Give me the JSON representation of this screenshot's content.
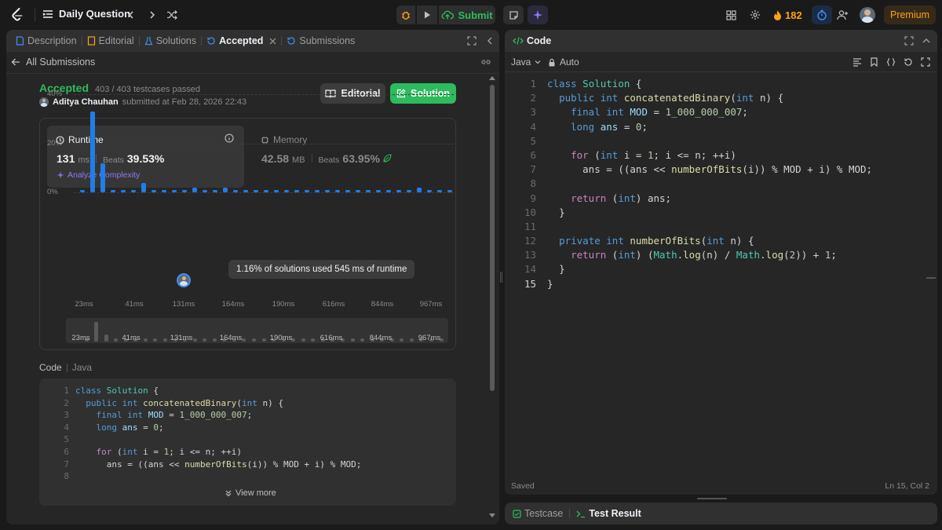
{
  "topbar": {
    "problem_list_label": "Daily Question",
    "submit_label": "Submit",
    "streak_count": "182",
    "premium_label": "Premium"
  },
  "left_panel": {
    "tabs": [
      {
        "label": "Description"
      },
      {
        "label": "Editorial"
      },
      {
        "label": "Solutions"
      },
      {
        "label": "Accepted"
      },
      {
        "label": "Submissions"
      }
    ],
    "back_label": "All Submissions",
    "status": "Accepted",
    "testcases": "403 / 403 testcases passed",
    "user_name": "Aditya Chauhan",
    "submitted_at": "submitted at Feb 28, 2026 22:43",
    "editorial_button": "Editorial",
    "solution_button": "Solution",
    "runtime": {
      "label": "Runtime",
      "value": "131",
      "unit": "ms",
      "beats_label": "Beats",
      "beats_value": "39.53%",
      "analyze_label": "Analyze Complexity"
    },
    "memory": {
      "label": "Memory",
      "value": "42.58",
      "unit": "MB",
      "beats_label": "Beats",
      "beats_value": "63.95%"
    },
    "tooltip": "1.16% of solutions used 545 ms of runtime",
    "code_label": "Code",
    "code_lang": "Java",
    "view_more": "View more"
  },
  "chart_data": {
    "type": "bar",
    "y_ticks": [
      "40%",
      "20%",
      "0%"
    ],
    "ylim": [
      0,
      40
    ],
    "x_tick_labels": [
      "23ms",
      "41ms",
      "131ms",
      "164ms",
      "190ms",
      "616ms",
      "844ms",
      "967ms"
    ],
    "values": [
      1,
      33,
      12,
      1,
      1,
      1,
      4,
      1,
      1,
      1,
      1,
      2,
      1,
      1,
      2,
      1,
      1,
      1,
      1,
      1,
      1,
      1,
      1,
      1,
      1,
      1,
      1,
      1,
      1,
      1,
      1,
      1,
      1,
      2,
      1,
      1,
      1
    ]
  },
  "right_panel": {
    "tab_label": "Code",
    "language": "Java",
    "mode": "Auto",
    "saved_label": "Saved",
    "cursor_pos": "Ln 15, Col 2",
    "bottom_tabs": [
      {
        "label": "Testcase"
      },
      {
        "label": "Test Result"
      }
    ]
  },
  "code_lines": [
    "class Solution {",
    "  public int concatenatedBinary(int n) {",
    "    final int MOD = 1_000_000_007;",
    "    long ans = 0;",
    "",
    "    for (int i = 1; i <= n; ++i)",
    "      ans = ((ans << numberOfBits(i)) % MOD + i) % MOD;",
    "",
    "    return (int) ans;",
    "  }",
    "",
    "  private int numberOfBits(int n) {",
    "    return (int) (Math.log(n) / Math.log(2)) + 1;",
    "  }",
    "}"
  ],
  "line_numbers": [
    "1",
    "2",
    "3",
    "4",
    "5",
    "6",
    "7",
    "8",
    "9",
    "10",
    "11",
    "12",
    "13",
    "14",
    "15"
  ]
}
